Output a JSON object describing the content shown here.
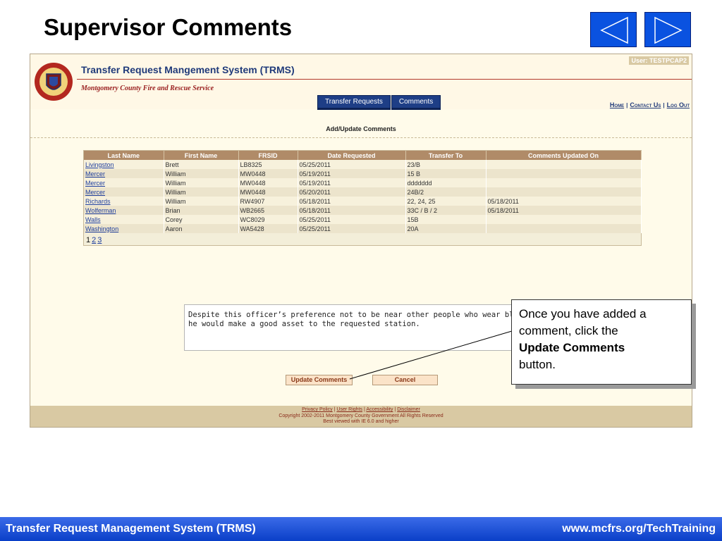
{
  "slide": {
    "title": "Supervisor Comments",
    "footer_left": "Transfer Request Management System (TRMS)",
    "footer_right": "www.mcfrs.org/TechTraining"
  },
  "nav": {
    "prev_icon": "triangle-left-icon",
    "next_icon": "triangle-right-icon"
  },
  "app": {
    "title": "Transfer Request Mangement System (TRMS)",
    "agency": "Montgomery County Fire and Rescue Service",
    "user_label": "User: TESTPCAP2",
    "tabs": [
      {
        "label": "Transfer Requests"
      },
      {
        "label": "Comments"
      }
    ],
    "top_links": {
      "home": "Home",
      "contact": "Contact Us",
      "logout": "Log Out",
      "sep": "|"
    },
    "section_title": "Add/Update Comments",
    "columns": [
      "Last Name",
      "First Name",
      "FRSID",
      "Date Requested",
      "Transfer To",
      "Comments Updated On"
    ],
    "rows": [
      {
        "last": "Livingston",
        "first": "Brett",
        "frsid": "LB8325",
        "date": "05/25/2011",
        "to": "23/B",
        "updated": ""
      },
      {
        "last": "Mercer",
        "first": "William",
        "frsid": "MW0448",
        "date": "05/19/2011",
        "to": "15 B",
        "updated": ""
      },
      {
        "last": "Mercer",
        "first": "William",
        "frsid": "MW0448",
        "date": "05/19/2011",
        "to": "ddddddd",
        "updated": ""
      },
      {
        "last": "Mercer",
        "first": "William",
        "frsid": "MW0448",
        "date": "05/20/2011",
        "to": "24B/2",
        "updated": ""
      },
      {
        "last": "Richards",
        "first": "William",
        "frsid": "RW4907",
        "date": "05/18/2011",
        "to": "22, 24, 25",
        "updated": "05/18/2011"
      },
      {
        "last": "Wolferman",
        "first": "Brian",
        "frsid": "WB2665",
        "date": "05/18/2011",
        "to": "33C / B / 2",
        "updated": "05/18/2011"
      },
      {
        "last": "Walls",
        "first": "Corey",
        "frsid": "WC8029",
        "date": "05/25/2011",
        "to": "15B",
        "updated": ""
      },
      {
        "last": "Washington",
        "first": "Aaron",
        "frsid": "WA5428",
        "date": "05/25/2011",
        "to": "20A",
        "updated": ""
      }
    ],
    "pager": {
      "current": "1",
      "pages": [
        "2",
        "3"
      ]
    },
    "comment_text": "Despite this officer’s preference not to be near other people who wear blue, he would make a good asset to the requested station.",
    "buttons": {
      "update": "Update Comments",
      "cancel": "Cancel"
    },
    "footer": {
      "privacy": "Privacy Policy",
      "rights": "User Rights",
      "access": "Accessibility",
      "disclaimer": "Disclaimer",
      "sep": "|",
      "copyright": "Copyright 2002-2011 Montgomery County Government All Rights Reserved",
      "best_viewed": "Best viewed with IE 6.0 and higher"
    }
  },
  "callout": {
    "pre": "Once you have added a comment, click the",
    "bold": "Update Comments",
    "post": "button."
  }
}
